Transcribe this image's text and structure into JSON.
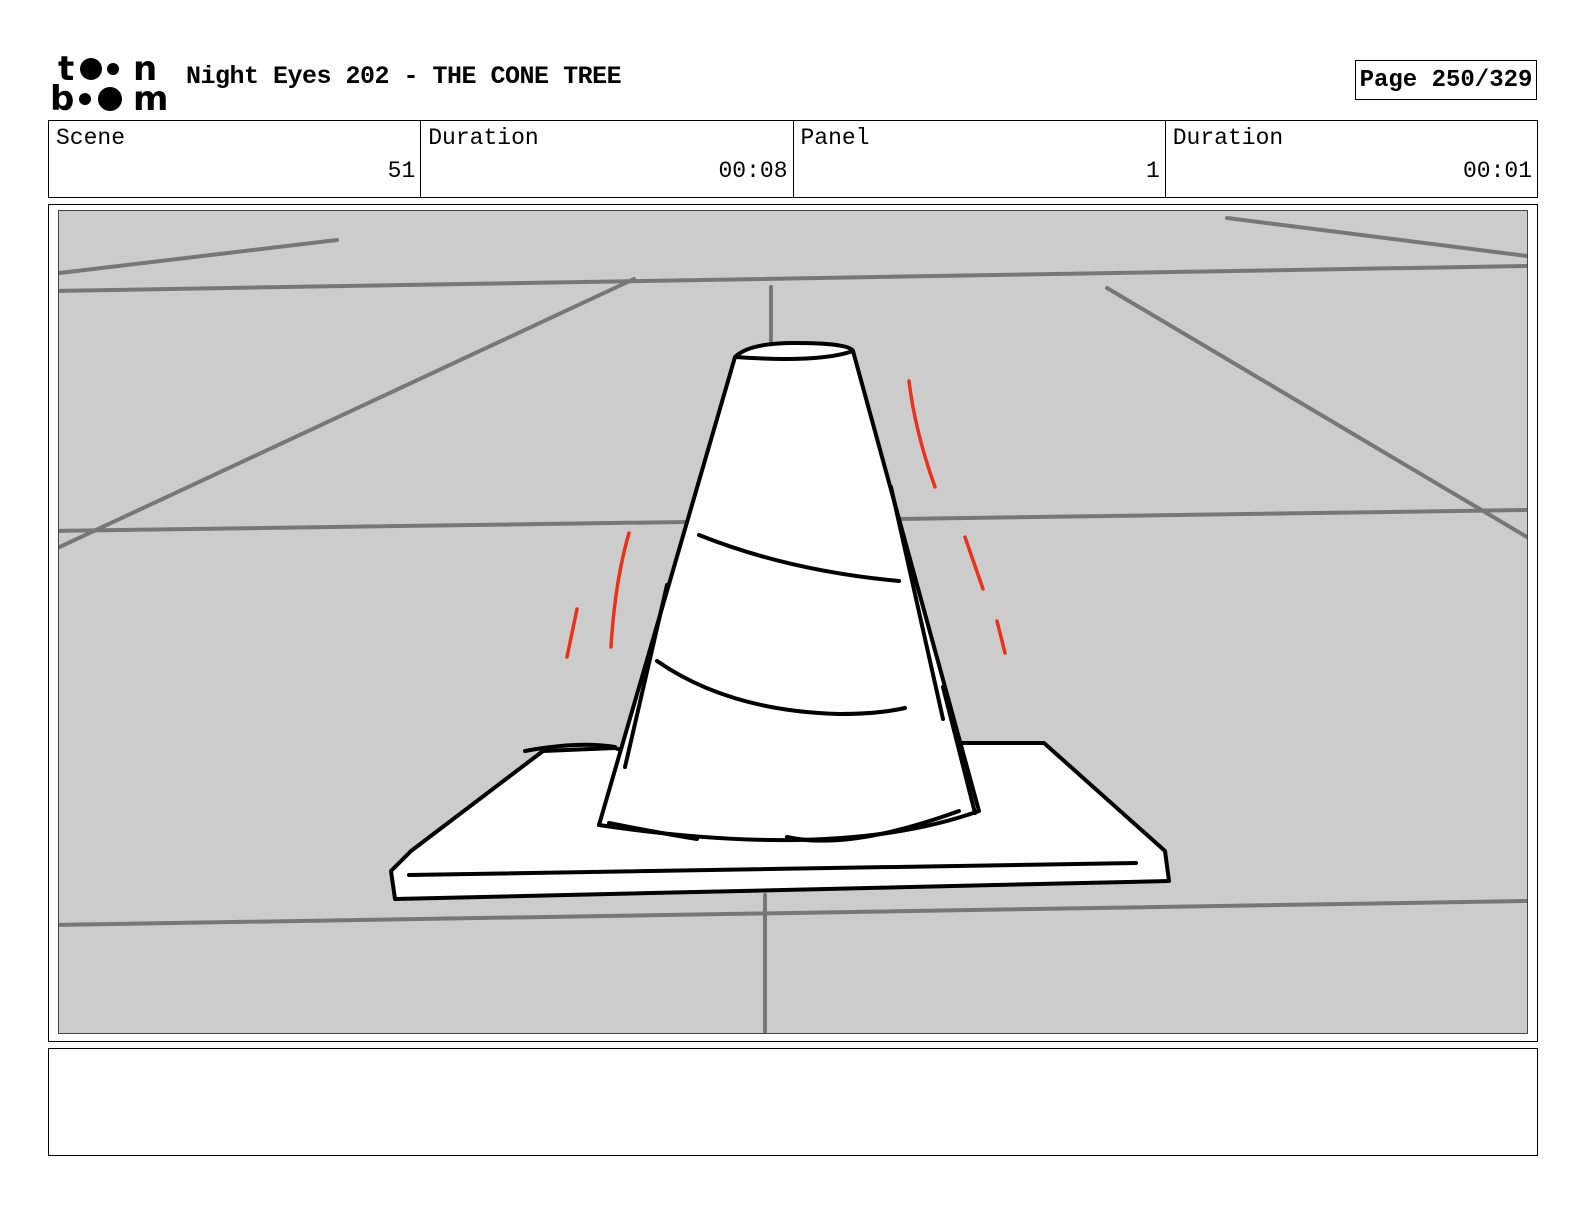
{
  "header": {
    "logo_icon": "toon-boom-logo-icon",
    "project_title": "Night Eyes 202 - THE CONE TREE",
    "page_label": "Page 250/329"
  },
  "info": [
    {
      "label": "Scene",
      "value": "51"
    },
    {
      "label": "Duration",
      "value": "00:08"
    },
    {
      "label": "Panel",
      "value": "1"
    },
    {
      "label": "Duration",
      "value": "00:01"
    }
  ],
  "panel": {
    "image_subject": "traffic-cone-sketch",
    "colors": {
      "floor": "#cccccc",
      "floor_lines": "#777777",
      "cone_fill": "#ffffff",
      "cone_outline": "#000000",
      "motion_lines": "#e8321a"
    }
  },
  "notes": {
    "action_text": ""
  }
}
